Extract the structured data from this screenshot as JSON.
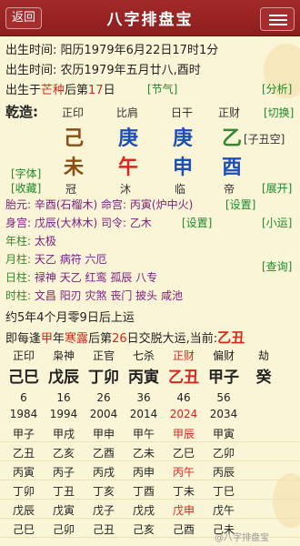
{
  "header": {
    "back": "返回",
    "title": "八字排盘宝",
    "menu_icon": "menu-icon"
  },
  "info": {
    "solar": "出生时间: 阳历1979年6月22日17时1分",
    "lunar": "出生时间: 农历1979年五月廿八,酉时",
    "jieqi_pre": "出生于",
    "jieqi_name": "芒种",
    "jieqi_mid": "后第",
    "jieqi_day": "17",
    "jieqi_post": "日",
    "jieqi_btn": "[节气]",
    "analysis_btn": "[分析]"
  },
  "chart": {
    "label": "乾造:",
    "headers": [
      "正印",
      "比肩",
      "日干",
      "正财"
    ],
    "switch_btn": "[切换]",
    "stems": [
      "己",
      "庚",
      "庚",
      "乙"
    ],
    "kongwang": "[子丑空]",
    "branches": [
      "未",
      "午",
      "申",
      "酉"
    ],
    "stages": [
      "冠",
      "沐",
      "临",
      "帝"
    ],
    "font_btn": "[字体]",
    "collect_btn": "[收藏]",
    "expand_btn": "[展开]"
  },
  "details": {
    "taiyuan": "胎元: 辛酉(石榴木) 命宫: 丙寅(炉中火)",
    "setting1": "[设置]",
    "shengong": "身宫: 戊辰(大林木) 司令: 乙木",
    "setting2": "[设置]",
    "xiaoyun": "[小运]",
    "nianzhu_label": "年柱:",
    "nianzhu": "太极",
    "yuezhu_label": "月柱:",
    "yuezhu": "天乙 病符 六厄",
    "rizhu_label": "日柱:",
    "rizhu": "禄神 天乙 红鸾 孤辰 八专",
    "query_btn": "[查询]",
    "shizhu_label": "时柱:",
    "shizhu": "文昌 阳刃 灾煞 丧门 披头 咸池",
    "qiyun": "约5年4个月零9日后上运",
    "jiaoyun_pre": "即每逢",
    "jiaoyun_stem": "甲",
    "jiaoyun_mid": "年",
    "jiaoyun_jieqi": "寒露",
    "jiaoyun_mid2": "后第",
    "jiaoyun_day": "26",
    "jiaoyun_post": "日交脱大运,当前:",
    "jiaoyun_current": "乙丑"
  },
  "dayun": {
    "gods": [
      "正印",
      "枭神",
      "正官",
      "七杀",
      "正财",
      "偏财",
      "劫"
    ],
    "ganzhi": [
      "己巳",
      "戊辰",
      "丁卯",
      "丙寅",
      "乙丑",
      "甲子",
      "癸"
    ],
    "ages": [
      "6",
      "16",
      "26",
      "36",
      "46",
      "56",
      ""
    ],
    "years": [
      "1984",
      "1994",
      "2004",
      "2014",
      "2024",
      "2034",
      ""
    ],
    "flow": [
      [
        "甲子",
        "甲戌",
        "甲申",
        "甲午",
        "甲辰",
        "甲寅",
        ""
      ],
      [
        "乙丑",
        "乙亥",
        "乙酉",
        "乙未",
        "乙巳",
        "乙卯",
        ""
      ],
      [
        "丙寅",
        "丙子",
        "丙戌",
        "丙申",
        "丙午",
        "丙辰",
        ""
      ],
      [
        "丁卯",
        "丁丑",
        "丁亥",
        "丁酉",
        "丁未",
        "丁巳",
        ""
      ],
      [
        "戊辰",
        "戊寅",
        "戊子",
        "戊戌",
        "戊申",
        "戊午",
        ""
      ],
      [
        "己巳",
        "己卯",
        "己丑",
        "己亥",
        "己酉",
        "己未",
        ""
      ]
    ]
  },
  "watermark": "@八字排盘宝"
}
